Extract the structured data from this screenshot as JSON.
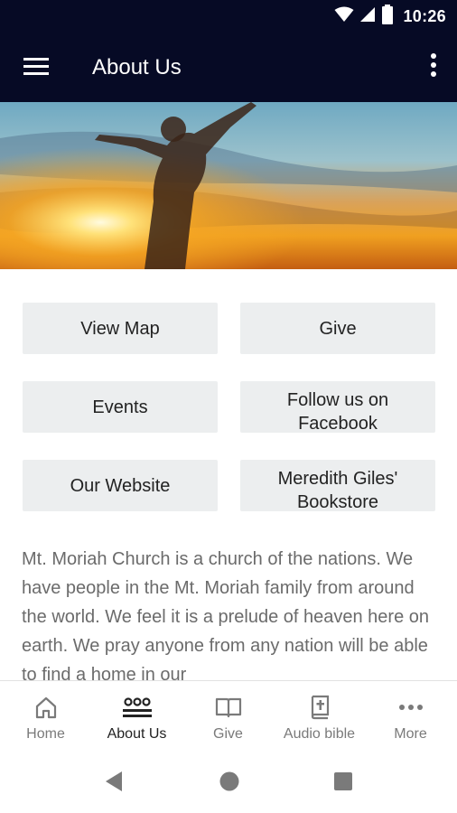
{
  "status_bar": {
    "time": "10:26",
    "icons": [
      "wifi-icon",
      "signal-icon",
      "battery-icon"
    ]
  },
  "app_bar": {
    "title": "About Us",
    "menu_icon": "hamburger-menu-icon",
    "overflow_icon": "more-vert-icon"
  },
  "hero": {
    "description_icon": "hero-image"
  },
  "buttons": [
    {
      "label": "View Map"
    },
    {
      "label": "Give"
    },
    {
      "label": "Events"
    },
    {
      "label": "Follow us on Facebook"
    },
    {
      "label": "Our Website"
    },
    {
      "label": "Meredith Giles' Bookstore"
    }
  ],
  "about": {
    "text": "Mt. Moriah Church is a church of the nations. We have people in the Mt. Moriah family from around the world.  We feel it is a prelude of heaven here on earth.  We pray anyone from any nation will be able to find a home in our"
  },
  "bottom_nav": {
    "items": [
      {
        "label": "Home",
        "icon": "home-icon"
      },
      {
        "label": "About Us",
        "icon": "people-icon",
        "active": true
      },
      {
        "label": "Give",
        "icon": "book-open-icon"
      },
      {
        "label": "Audio bible",
        "icon": "bible-icon"
      },
      {
        "label": "More",
        "icon": "more-horiz-icon"
      }
    ]
  },
  "system_nav": {
    "icons": [
      "back-icon",
      "home-circle-icon",
      "recents-icon"
    ]
  },
  "colors": {
    "app_bar": "#060a25",
    "button_bg": "#eceeef",
    "body_text": "#6b6b6b",
    "active_nav": "#222222",
    "inactive_nav": "#7a7a7a"
  }
}
